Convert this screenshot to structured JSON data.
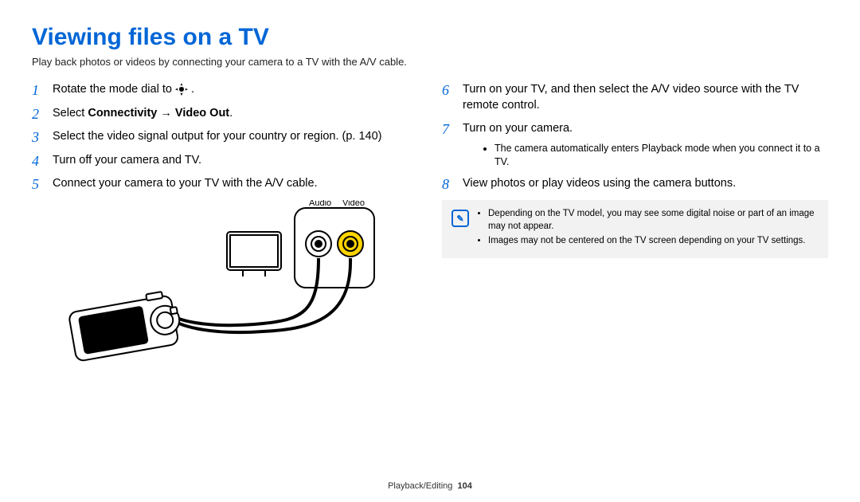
{
  "title": "Viewing files on a TV",
  "subtitle": "Play back photos or videos by connecting your camera to a TV with the A/V cable.",
  "left": {
    "steps": [
      {
        "n": "1",
        "pre": "Rotate the mode dial to ",
        "post": " ."
      },
      {
        "n": "2",
        "pre": "Select ",
        "bold": "Connectivity → Video Out",
        "post": "."
      },
      {
        "n": "3",
        "text": "Select the video signal output for your country or region. (p. 140)"
      },
      {
        "n": "4",
        "text": "Turn off your camera and TV."
      },
      {
        "n": "5",
        "text": "Connect your camera to your TV with the A/V cable."
      }
    ],
    "labels": {
      "audio": "Audio",
      "video": "Video"
    }
  },
  "right": {
    "steps": [
      {
        "n": "6",
        "text": "Turn on your TV, and then select the A/V video source with the TV remote control."
      },
      {
        "n": "7",
        "text": "Turn on your camera.",
        "sub": [
          "The camera automatically enters Playback mode when you connect it to a TV."
        ]
      },
      {
        "n": "8",
        "text": "View photos or play videos using the camera buttons."
      }
    ],
    "note": [
      "Depending on the TV model, you may see some digital noise or part of an image may not appear.",
      "Images may not be centered on the TV screen depending on your TV settings."
    ]
  },
  "footer": {
    "section": "Playback/Editing",
    "page": "104"
  }
}
